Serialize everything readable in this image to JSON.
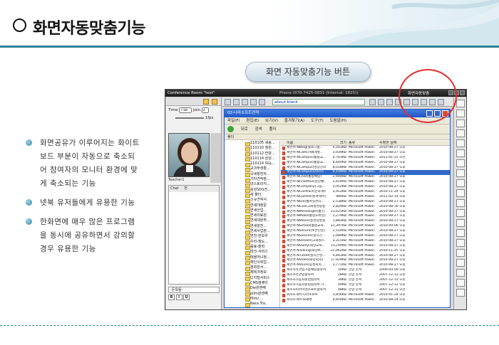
{
  "slide": {
    "title": "화면자동맞춤기능",
    "button_label": "화면 자동맞춤기능 버튼",
    "bullets": [
      "화면공유가 이루어지는 화이트보드 부분이 자동으로 축소되어 참여자의 모니터 환경에 맞게 축소되는 기능",
      "넷북 유저들에게 유용한 기능",
      "한화면에 매우 많은 프로그램을 동시에 공유하면서 강의할경우 유용한 기능"
    ],
    "accent_color": "#2f7f96"
  },
  "app": {
    "title": "Conference Room \"test\"",
    "phone": "Phone (070-7425-0831 (Internal: 1825))",
    "time_label": "Time",
    "time_value": "7:58",
    "join_label": "Join",
    "join_value": "2",
    "fps": "1fps",
    "teacher_name": "Teacher1",
    "chat_label": "Chat",
    "chat_all": "전",
    "chat_select": "-돈욕들-",
    "format_buttons": [
      "B",
      "I",
      "U"
    ],
    "address": "about:blank",
    "screen_fit_button": "화면자동맞춤"
  },
  "explorer": {
    "title": "02-나라소프트견적",
    "menu": [
      "파일(F)",
      "편집(E)",
      "보기(V)",
      "즐겨찾기(A)",
      "도구(T)",
      "도움말(H)"
    ],
    "toolbar": [
      "뒤로",
      "검색",
      "폴더"
    ],
    "tree_header": "폴더",
    "tree_items": [
      "110105 세종...",
      "110110 청원...",
      "110112 한양...",
      "110114 삼성...",
      "110114 SGL...",
      "교과부생활...",
      "국세청전자...",
      "기타견적참...",
      "넷스토리지...",
      "삼성SDS견...",
      "새 폴더",
      "신규견적서",
      "연세대정문",
      "연세산업...",
      "연세의료원",
      "연세대원주...",
      "연세암전...",
      "연세사업본...",
      "연천-한보우",
      "우리-청도...",
      "음료-출력",
      "테크-서비스",
      "태을머니청...",
      "재인사회업...",
      "정회원서...",
      "제테크정보",
      "디지털서비스",
      "CMS컴퓨터",
      "Dw원엔쩨",
      "pilm원엔쩨",
      "Pilm/...",
      "Nara Tra..",
      "NBlog형식",
      "WW 제조..."
    ],
    "columns": [
      "이름",
      "크기",
      "종류",
      "수정한 날짜"
    ],
    "files": [
      {
        "name": "제안서-NBlog(블로그협...",
        "size": "4,503KB",
        "type": "Microsoft Power...",
        "date": "2010-08-27 오후"
      },
      {
        "name": "제안서-NCafe(카페개발...",
        "size": "3,939KB",
        "type": "Microsoft Power...",
        "date": "2010-08-27 오후"
      },
      {
        "name": "제안서-NCampus(통합교...",
        "size": "4,763KB",
        "type": "Microsoft Power...",
        "date": "2011-01-15 오전"
      },
      {
        "name": "제안서-NCampus(통합교...",
        "size": "8,449KB",
        "type": "Microsoft Power...",
        "date": "2010-08-27 오후"
      },
      {
        "name": "제안서-NCampus(영상강의)",
        "size": "8,018KB",
        "type": "Microsoft Power...",
        "date": "2010-08-27 오후"
      },
      {
        "name": "제안서-NCampus(2010)",
        "size": "8,104KB",
        "type": "Microsoft Power...",
        "date": "2010-08-27 오후"
      },
      {
        "name": "제안서-NChat(통합채팅)",
        "size": "2,944KB",
        "type": "Microsoft Power...",
        "date": "2010-08-27 오후"
      },
      {
        "name": "제안서-NChatPlus(영상채...",
        "size": "3,424KB",
        "type": "Microsoft Power...",
        "date": "2010-08-27 오후"
      },
      {
        "name": "제안서-NCompany(그룹...",
        "size": "5,052KB",
        "type": "Microsoft Power...",
        "date": "2010-08-27 오후"
      },
      {
        "name": "제안서-NContract(전자계약)",
        "size": "3,912KB",
        "type": "Microsoft Power...",
        "date": "2010-11-24 오후"
      },
      {
        "name": "제안서-NControl(원격제어)",
        "size": "984KB",
        "type": "Microsoft Power...",
        "date": "2011-02-14 오후"
      },
      {
        "name": "제안서-NFile(웹파일관리...",
        "size": "2,538KB",
        "type": "Microsoft Power...",
        "date": "2010-08-27 오후"
      },
      {
        "name": "제안서-NLive(고화질영방송)",
        "size": "2,829KB",
        "type": "Microsoft Power...",
        "date": "2010-08-30 오후"
      },
      {
        "name": "제안서-NMessenger(통신...",
        "size": "13,621KB",
        "type": "Microsoft Power...",
        "date": "2010-08-27 오후"
      },
      {
        "name": "제안서-NMobil(통합모바일)",
        "size": "2,279KB",
        "type": "Microsoft Power...",
        "date": "2010-08-27 오후"
      },
      {
        "name": "제안서-NMovie(동영상방송)",
        "size": "1,883KB",
        "type": "Microsoft Power...",
        "date": "2010-08-27 오후"
      },
      {
        "name": "제안서-NSchool(통합교육...",
        "size": "21,397KB",
        "type": "Microsoft Power...",
        "date": "2010-09-06 오후"
      },
      {
        "name": "제안서-NSecure(보안인증)",
        "size": "2,514KB",
        "type": "Microsoft Power...",
        "date": "2010-08-27 오후"
      },
      {
        "name": "제안서-NSession(실시간...",
        "size": "2,689KB",
        "type": "Microsoft Power...",
        "date": "2010-08-27 오후"
      },
      {
        "name": "제안서-NStream(고화질스...",
        "size": "3,311KB",
        "type": "Microsoft Power...",
        "date": "2010-08-27 오후"
      },
      {
        "name": "제안서-NStudy(화상교육...",
        "size": "13,249KB",
        "type": "Microsoft Power...",
        "date": "2010-08-27 오후"
      },
      {
        "name": "제안서-NTalking(화상토...",
        "size": "21,062KB",
        "type": "Microsoft Power...",
        "date": "2010-11-25 오후"
      },
      {
        "name": "제안서-NTicket(실시간영...",
        "size": "4,843KB",
        "type": "Microsoft Power...",
        "date": "2010-08-27 오후"
      },
      {
        "name": "제안서-NVideo(화상회의)",
        "size": "17,929KB",
        "type": "Microsoft Power...",
        "date": "2010-08-27 오후"
      },
      {
        "name": "제안서-NVoice(음성회의...",
        "size": "3,771KB",
        "type": "Microsoft Power...",
        "date": "2010-08-27 오후"
      },
      {
        "name": "제조사유관업가용채팅협약서",
        "size": "50KB",
        "type": "한글 문서",
        "date": "2009-04-09 오후"
      },
      {
        "name": "제조사유관업협약서",
        "size": "28KB",
        "type": "한글 문서",
        "date": "2007-12-12 오후"
      },
      {
        "name": "제조사가음자원업협약서",
        "size": "39KB",
        "type": "한글 문서",
        "date": "2007-12-12 오후"
      },
      {
        "name": "제조사가음자원업협약서-가...",
        "size": "49KB",
        "type": "한글 문서",
        "date": "2007-12-12 오후"
      },
      {
        "name": "제조사피아이엔소프트협약서",
        "size": "48KB",
        "type": "한글 문서",
        "date": "2007-12-31 오전"
      },
      {
        "name": "회사소개서-나라소프트",
        "size": "3,856KB",
        "type": "Microsoft Power...",
        "date": "2010-01-24 오후"
      },
      {
        "name": "회사소개서-화재명",
        "size": "4,850KB",
        "type": "Microsoft Power...",
        "date": "2010-08-24 오후"
      }
    ]
  }
}
